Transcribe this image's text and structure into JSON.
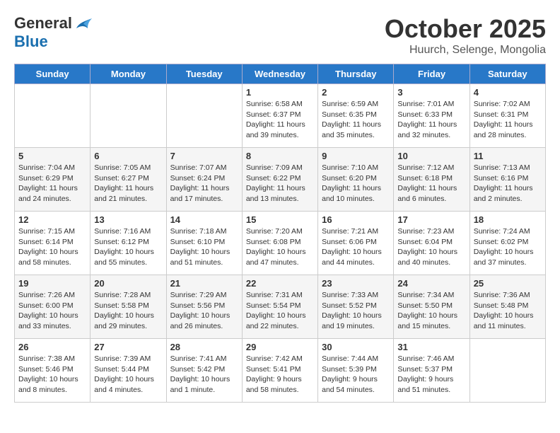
{
  "logo": {
    "general": "General",
    "blue": "Blue"
  },
  "title": "October 2025",
  "location": "Huurch, Selenge, Mongolia",
  "weekdays": [
    "Sunday",
    "Monday",
    "Tuesday",
    "Wednesday",
    "Thursday",
    "Friday",
    "Saturday"
  ],
  "weeks": [
    [
      {
        "day": "",
        "info": ""
      },
      {
        "day": "",
        "info": ""
      },
      {
        "day": "",
        "info": ""
      },
      {
        "day": "1",
        "info": "Sunrise: 6:58 AM\nSunset: 6:37 PM\nDaylight: 11 hours\nand 39 minutes."
      },
      {
        "day": "2",
        "info": "Sunrise: 6:59 AM\nSunset: 6:35 PM\nDaylight: 11 hours\nand 35 minutes."
      },
      {
        "day": "3",
        "info": "Sunrise: 7:01 AM\nSunset: 6:33 PM\nDaylight: 11 hours\nand 32 minutes."
      },
      {
        "day": "4",
        "info": "Sunrise: 7:02 AM\nSunset: 6:31 PM\nDaylight: 11 hours\nand 28 minutes."
      }
    ],
    [
      {
        "day": "5",
        "info": "Sunrise: 7:04 AM\nSunset: 6:29 PM\nDaylight: 11 hours\nand 24 minutes."
      },
      {
        "day": "6",
        "info": "Sunrise: 7:05 AM\nSunset: 6:27 PM\nDaylight: 11 hours\nand 21 minutes."
      },
      {
        "day": "7",
        "info": "Sunrise: 7:07 AM\nSunset: 6:24 PM\nDaylight: 11 hours\nand 17 minutes."
      },
      {
        "day": "8",
        "info": "Sunrise: 7:09 AM\nSunset: 6:22 PM\nDaylight: 11 hours\nand 13 minutes."
      },
      {
        "day": "9",
        "info": "Sunrise: 7:10 AM\nSunset: 6:20 PM\nDaylight: 11 hours\nand 10 minutes."
      },
      {
        "day": "10",
        "info": "Sunrise: 7:12 AM\nSunset: 6:18 PM\nDaylight: 11 hours\nand 6 minutes."
      },
      {
        "day": "11",
        "info": "Sunrise: 7:13 AM\nSunset: 6:16 PM\nDaylight: 11 hours\nand 2 minutes."
      }
    ],
    [
      {
        "day": "12",
        "info": "Sunrise: 7:15 AM\nSunset: 6:14 PM\nDaylight: 10 hours\nand 58 minutes."
      },
      {
        "day": "13",
        "info": "Sunrise: 7:16 AM\nSunset: 6:12 PM\nDaylight: 10 hours\nand 55 minutes."
      },
      {
        "day": "14",
        "info": "Sunrise: 7:18 AM\nSunset: 6:10 PM\nDaylight: 10 hours\nand 51 minutes."
      },
      {
        "day": "15",
        "info": "Sunrise: 7:20 AM\nSunset: 6:08 PM\nDaylight: 10 hours\nand 47 minutes."
      },
      {
        "day": "16",
        "info": "Sunrise: 7:21 AM\nSunset: 6:06 PM\nDaylight: 10 hours\nand 44 minutes."
      },
      {
        "day": "17",
        "info": "Sunrise: 7:23 AM\nSunset: 6:04 PM\nDaylight: 10 hours\nand 40 minutes."
      },
      {
        "day": "18",
        "info": "Sunrise: 7:24 AM\nSunset: 6:02 PM\nDaylight: 10 hours\nand 37 minutes."
      }
    ],
    [
      {
        "day": "19",
        "info": "Sunrise: 7:26 AM\nSunset: 6:00 PM\nDaylight: 10 hours\nand 33 minutes."
      },
      {
        "day": "20",
        "info": "Sunrise: 7:28 AM\nSunset: 5:58 PM\nDaylight: 10 hours\nand 29 minutes."
      },
      {
        "day": "21",
        "info": "Sunrise: 7:29 AM\nSunset: 5:56 PM\nDaylight: 10 hours\nand 26 minutes."
      },
      {
        "day": "22",
        "info": "Sunrise: 7:31 AM\nSunset: 5:54 PM\nDaylight: 10 hours\nand 22 minutes."
      },
      {
        "day": "23",
        "info": "Sunrise: 7:33 AM\nSunset: 5:52 PM\nDaylight: 10 hours\nand 19 minutes."
      },
      {
        "day": "24",
        "info": "Sunrise: 7:34 AM\nSunset: 5:50 PM\nDaylight: 10 hours\nand 15 minutes."
      },
      {
        "day": "25",
        "info": "Sunrise: 7:36 AM\nSunset: 5:48 PM\nDaylight: 10 hours\nand 11 minutes."
      }
    ],
    [
      {
        "day": "26",
        "info": "Sunrise: 7:38 AM\nSunset: 5:46 PM\nDaylight: 10 hours\nand 8 minutes."
      },
      {
        "day": "27",
        "info": "Sunrise: 7:39 AM\nSunset: 5:44 PM\nDaylight: 10 hours\nand 4 minutes."
      },
      {
        "day": "28",
        "info": "Sunrise: 7:41 AM\nSunset: 5:42 PM\nDaylight: 10 hours\nand 1 minute."
      },
      {
        "day": "29",
        "info": "Sunrise: 7:42 AM\nSunset: 5:41 PM\nDaylight: 9 hours\nand 58 minutes."
      },
      {
        "day": "30",
        "info": "Sunrise: 7:44 AM\nSunset: 5:39 PM\nDaylight: 9 hours\nand 54 minutes."
      },
      {
        "day": "31",
        "info": "Sunrise: 7:46 AM\nSunset: 5:37 PM\nDaylight: 9 hours\nand 51 minutes."
      },
      {
        "day": "",
        "info": ""
      }
    ]
  ]
}
